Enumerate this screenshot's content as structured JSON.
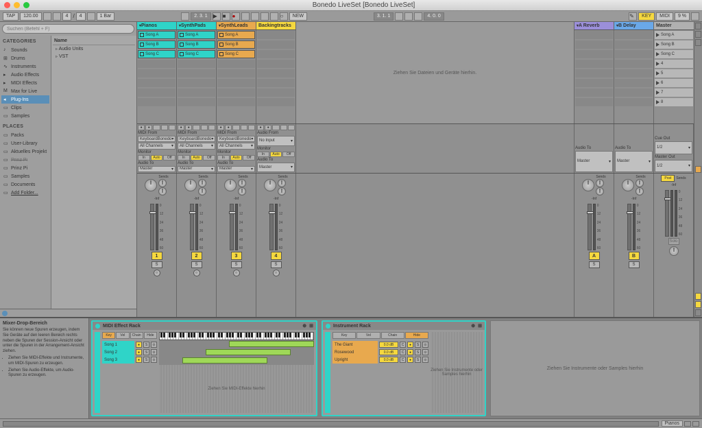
{
  "window": {
    "title": "Bonedo LiveSet  [Bonedo LiveSet]"
  },
  "topbar": {
    "tap": "TAP",
    "tempo": "120.00",
    "sig_num": "4",
    "sig_den": "4",
    "metro": "●",
    "quantize": "1 Bar",
    "pos": "2. 3. 1",
    "new": "NEW",
    "loop_start": "3. 1. 1",
    "loop_len": "4. 0. 0",
    "key": "KEY",
    "midi": "MIDI",
    "cpu": "9 %"
  },
  "browser": {
    "search_placeholder": "Suchen (Befehl + F)",
    "cat_header": "CATEGORIES",
    "categories": [
      "Sounds",
      "Drums",
      "Instruments",
      "Audio Effects",
      "MIDI Effects",
      "Max for Live",
      "Plug-Ins",
      "Clips",
      "Samples"
    ],
    "places_header": "PLACES",
    "places": [
      "Packs",
      "User-Library",
      "Aktuelles Projekt",
      "Prinz Pi",
      "Prinz Pi",
      "Samples",
      "Documents",
      "Add Folder..."
    ],
    "content_header": "Name",
    "content_items": [
      "Audio Units",
      "VST"
    ]
  },
  "tracks": [
    {
      "name": "Pianos",
      "color": "cy",
      "clips": [
        "Song A",
        "Song B",
        "Song C"
      ],
      "clipcolor": "cy",
      "num": "1",
      "btncolor": "ye"
    },
    {
      "name": "SynthPads",
      "color": "cy",
      "clips": [
        "Song A",
        "Song B",
        "Song C"
      ],
      "clipcolor": "cy",
      "num": "2",
      "btncolor": "ye"
    },
    {
      "name": "SynthLeads",
      "color": "or",
      "clips": [
        "Song A",
        "Song B",
        "Song C"
      ],
      "clipcolor": "or",
      "num": "3",
      "btncolor": "ye"
    },
    {
      "name": "Backingtracks",
      "color": "ye",
      "clips": [],
      "clipcolor": "",
      "num": "4",
      "btncolor": "ye"
    }
  ],
  "returns": [
    {
      "name": "A Reverb",
      "color": "pu",
      "letter": "A"
    },
    {
      "name": "B Delay",
      "color": "bl",
      "letter": "B"
    }
  ],
  "master": {
    "name": "Master",
    "color": "gr"
  },
  "scenes": [
    "Song A",
    "Song B",
    "Song C",
    "4",
    "5",
    "6",
    "7",
    "8"
  ],
  "drop_hint": "Ziehen Sie Dateien und Geräte hierhin.",
  "io": {
    "midi_from": "MIDI From",
    "audio_from": "Audio From",
    "kb": "KeyboardBonedo",
    "all_ch": "All Channels",
    "no_input": "No Input",
    "monitor": "Monitor",
    "in": "In",
    "auto": "Auto",
    "off": "Off",
    "audio_to": "Audio To",
    "master": "Master",
    "cue_out": "Cue Out",
    "master_out": "Master Out",
    "out12": "1/2"
  },
  "mixer": {
    "sends": "Sends",
    "inf": "-Inf",
    "post": "Post",
    "ticks": [
      "0",
      "12",
      "24",
      "36",
      "48",
      "60"
    ],
    "s": "S"
  },
  "info": {
    "title": "Mixer-Drop-Bereich",
    "p1": "Sie können neue Spuren erzeugen, indem Sie Geräte auf den leeren Bereich rechts neben die Spuren der Session-Ansicht oder unter die Spuren in der Arrangement-Ansicht ziehen.",
    "li1": "Ziehen Sie MIDI-Effekte und Instrumente, um MIDI-Spuren zu erzeugen.",
    "li2": "Ziehen Sie Audio-Effekte, um Audio-Spuren zu erzeugen."
  },
  "midirack": {
    "title": "MIDI Effect Rack",
    "btns": [
      "Key",
      "Vel",
      "Chain",
      "Hide"
    ],
    "chains": [
      "Song 1",
      "Song 2",
      "Song 3"
    ],
    "drop": "Ziehen Sie MIDI-Effekte hierhin"
  },
  "instrack": {
    "title": "Instrument Rack",
    "btns": [
      "Key",
      "Vel",
      "Chain",
      "Hide"
    ],
    "chains": [
      {
        "name": "The Giant",
        "db": "0.0 dB"
      },
      {
        "name": "Rosewood",
        "db": "0.0 dB"
      },
      {
        "name": "Upright",
        "db": "0.0 dB"
      }
    ],
    "letter_c": "C",
    "drop": "Ziehen Sie Instrumente oder Samples hierhin"
  },
  "rightdrop": "Ziehen Sie Instrumente oder Samples hierhin",
  "status": {
    "track": "Pianos"
  }
}
